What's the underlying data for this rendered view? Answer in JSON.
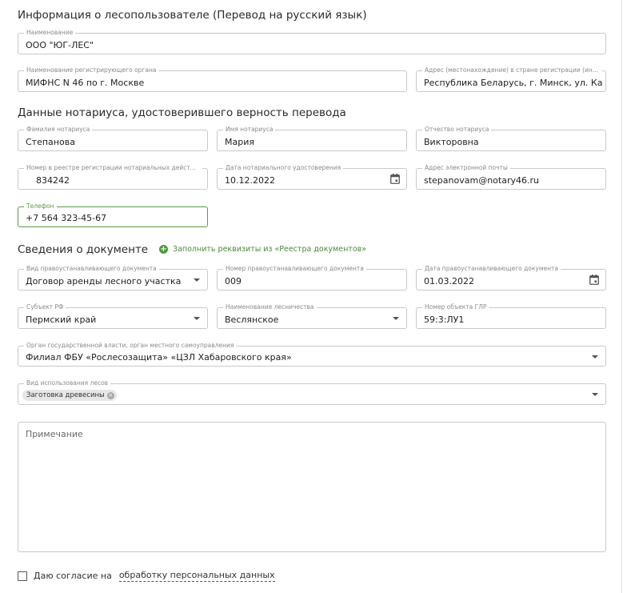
{
  "colors": {
    "accent": "#4c8a3a",
    "border": "#c9c9c9",
    "label": "#8a8a8a"
  },
  "section_user": {
    "title": "Информация о лесопользователе (Перевод на русский язык)",
    "name_label": "Наименование",
    "name_value": "ООО \"ЮГ-ЛЕС\"",
    "reg_org_label": "Наименование регистрирующего органа",
    "reg_org_value": "МИФНС N 46 по г. Москве",
    "address_label": "Адрес (местонахождение) в стране регистрации (ин...",
    "address_value": "Республика Беларусь, г. Минск, ул. Карл"
  },
  "section_notary": {
    "title": "Данные нотариуса, удостоверившего верность перевода",
    "lastname_label": "Фамилия нотариуса",
    "lastname_value": "Степанова",
    "firstname_label": "Имя нотариуса",
    "firstname_value": "Мария",
    "patronymic_label": "Отчество нотариуса",
    "patronymic_value": "Викторовна",
    "reg_number_label": "Номер в реестре регистрации нотариальных дейст...",
    "reg_number_value": "834242",
    "cert_date_label": "Дата нотариального удостоверения",
    "cert_date_value": "10.12.2022",
    "email_label": "Адрес электронной почты",
    "email_value": "stepanovam@notary46.ru",
    "phone_label": "Телефон",
    "phone_value": "+7 564 323-45-67"
  },
  "section_document": {
    "title": "Сведения о документе",
    "fill_link": "Заполнить реквизиты из «Реестра документов»",
    "doc_type_label": "Вид правоустанавливающего документа",
    "doc_type_value": "Договор аренды лесного участка",
    "doc_number_label": "Номер правоустанавливающего документа",
    "doc_number_value": "009",
    "doc_date_label": "Дата правоустанавливающего документа",
    "doc_date_value": "01.03.2022",
    "subject_label": "Субъект РФ",
    "subject_value": "Пермский край",
    "forestry_label": "Наименование лесничества",
    "forestry_value": "Веслянское",
    "glr_label": "Номер объекта ГЛР",
    "glr_value": "59:3:ЛУ1",
    "authority_label": "Орган государственной власти, орган местного самоуправления",
    "authority_value": "Филиал ФБУ «Рослесозащита» «ЦЗЛ Хабаровского края»",
    "forest_use_label": "Вид использования лесов",
    "forest_use_chip": "Заготовка древесины",
    "note_placeholder": "Примечание"
  },
  "consent": {
    "text": "Даю согласие на",
    "link": "обработку персональных данных"
  }
}
